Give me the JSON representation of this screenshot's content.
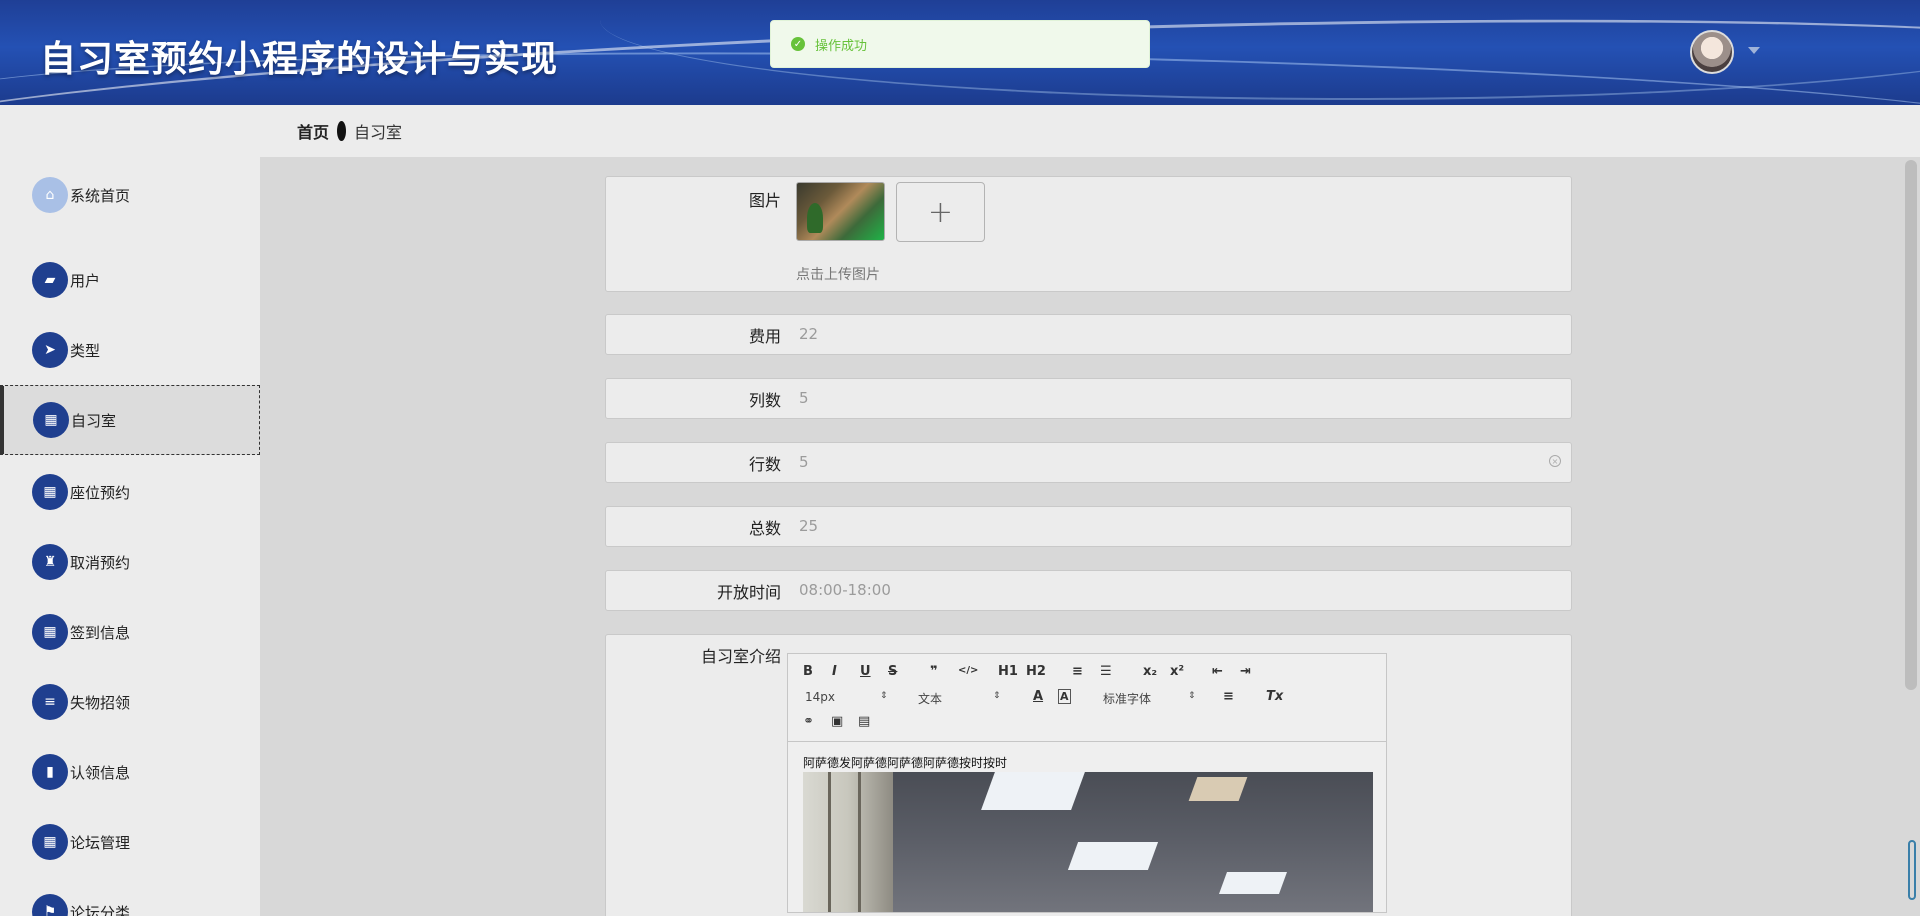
{
  "header": {
    "title": "自习室预约小程序的设计与实现"
  },
  "toast": {
    "message": "操作成功"
  },
  "breadcrumb": {
    "home": "首页",
    "current": "自习室"
  },
  "sidebar": {
    "items": [
      {
        "label": "系统首页",
        "icon": "home-icon"
      },
      {
        "label": "用户",
        "icon": "briefcase-icon"
      },
      {
        "label": "类型",
        "icon": "paper-plane-icon"
      },
      {
        "label": "自习室",
        "icon": "grid-icon",
        "active": true
      },
      {
        "label": "座位预约",
        "icon": "grid-icon"
      },
      {
        "label": "取消预约",
        "icon": "stamp-icon"
      },
      {
        "label": "签到信息",
        "icon": "grid-icon"
      },
      {
        "label": "失物招领",
        "icon": "list-icon"
      },
      {
        "label": "认领信息",
        "icon": "book-icon"
      },
      {
        "label": "论坛管理",
        "icon": "grid-icon"
      },
      {
        "label": "论坛分类",
        "icon": "flag-icon"
      }
    ]
  },
  "form": {
    "image_label": "图片",
    "upload_hint": "点击上传图片",
    "upload_button": "+",
    "fee_label": "费用",
    "fee_value": "22",
    "columns_label": "列数",
    "columns_value": "5",
    "rows_label": "行数",
    "rows_value": "5",
    "total_label": "总数",
    "total_value": "25",
    "open_time_label": "开放时间",
    "open_time_value": "08:00-18:00",
    "intro_label": "自习室介绍"
  },
  "editor": {
    "toolbar": {
      "bold": "B",
      "italic": "I",
      "underline": "U",
      "strike": "S",
      "blockquote": "❞",
      "code": "</>",
      "h1": "H1",
      "h2": "H2",
      "ordered_list": "≡",
      "bullet_list": "☰",
      "subscript": "x₂",
      "superscript": "x²",
      "outdent": "⇤",
      "indent": "⇥",
      "font_size": "14px",
      "block_format": "文本",
      "font_family": "标准字体",
      "clear_format": "Tx"
    },
    "content_text": "阿萨德发阿萨德阿萨德阿萨德按时按时"
  },
  "colors": {
    "header_bg": "#2451b4",
    "nav_icon_bg": "#1f3f8f",
    "toast_green": "#67c23a"
  }
}
